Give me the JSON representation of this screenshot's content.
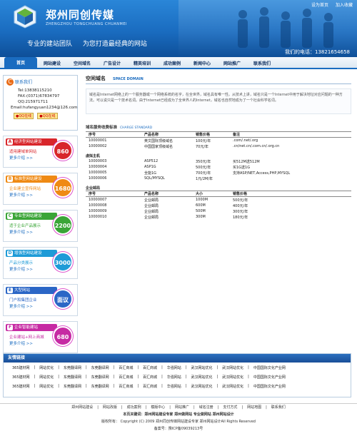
{
  "header": {
    "logo_text": "郑州同创传媒",
    "logo_sub": "ZHENGZHOU TONGCHUANG CHUANMEI",
    "top_links": [
      "设为首页",
      "加入收藏"
    ],
    "slogan": [
      "专业的建站团队",
      "为您打造最经典的网站"
    ],
    "phone": "我们的电话：13821654658"
  },
  "nav": {
    "items": [
      "首页",
      "网站建设",
      "空间域名",
      "广告设计",
      "精英培训",
      "成功案例",
      "新闻中心",
      "网站推广",
      "联系我们"
    ]
  },
  "contact": {
    "title": "联系我们",
    "lines": [
      "Tel:13838115210",
      "FAX:(0371)67834797",
      "QQ:215971711",
      "Email:hufangyuan1234@126.com"
    ],
    "qq_labels": [
      "QQ在线",
      "QQ在线"
    ]
  },
  "packages": [
    {
      "letter": "A",
      "name": "经济型网站建设",
      "l1": "适用建域单网站",
      "l2": "更多介绍 >>",
      "price": "860",
      "color": "#d8262b"
    },
    {
      "letter": "B",
      "name": "标准型网站建设",
      "l1": "企业建立宣传网站",
      "l2": "更多介绍 >>",
      "price": "1680",
      "color": "#ef8a14"
    },
    {
      "letter": "C",
      "name": "专业型网站建设",
      "l1": "适于企业产品展示",
      "l2": "更多介绍 >>",
      "price": "2200",
      "color": "#3aa537"
    },
    {
      "letter": "D",
      "name": "增强型网站建设",
      "l1": "产品分类展示",
      "l2": "更多介绍 >>",
      "price": "3000",
      "color": "#1e9bd7"
    },
    {
      "letter": "E",
      "name": "大型网站",
      "l1": "门户和集团企业",
      "l2": "更多介绍 >>",
      "price": "面议",
      "color": "#2b66c6"
    },
    {
      "letter": "F",
      "name": "企业智能建站",
      "l1": "企业建站+网上商城",
      "l2": "更多介绍 >>",
      "price": "680",
      "color": "#c62aa3"
    }
  ],
  "main": {
    "title": "空间域名",
    "title_en": "SPACE DOMAIN",
    "intro": "域名是Internet网络上的一个服务器或一个网络系统的名字，在全世界，域名具有唯一性。从技术上讲，域名只是一个Internet中用于解决地址对应问题的一种方法。可以说只是一个技术名词。由于Internet已经成为了全世界人的Internet，域名也自然地成为了一个社会科学名词。",
    "section_title": "域名服务收费标准",
    "section_en": "CHARGE STANDARD",
    "headers": [
      "序号",
      "产品名称",
      "销售价格",
      "备注"
    ],
    "domain_rows": [
      [
        "10000001",
        "英文国际顶级域名",
        "100元/年",
        ".com/.net/.org"
      ],
      [
        "10000002",
        "中国国家顶级域名",
        "70元/年",
        ".cn/net.cn/.com.cn/.org.cn"
      ]
    ],
    "vhost_title": "虚拟主机",
    "vhost_rows": [
      [
        "10000003",
        "ASP512",
        "350元/年",
        "买512M送512M"
      ],
      [
        "10000004",
        "ASP1G",
        "500元/年",
        "买1G送1G"
      ],
      [
        "10000005",
        "全能1G",
        "700元/年",
        "支持ASP/NET,Access,PHP,MYSQL"
      ],
      [
        "10000006",
        "SQL/MYSQL",
        "1元/2M/年",
        ""
      ]
    ],
    "mail_title": "企业邮局",
    "mail_headers": [
      "序号",
      "产品名称",
      "大小",
      "销售价格"
    ],
    "mail_rows": [
      [
        "10000007",
        "企业邮局",
        "1000M",
        "500元/年"
      ],
      [
        "10000008",
        "企业邮局",
        "600M",
        "400元/年"
      ],
      [
        "10000009",
        "企业邮局",
        "500M",
        "300元/年"
      ],
      [
        "10000010",
        "企业邮局",
        "300M",
        "180元/年"
      ]
    ]
  },
  "links": {
    "title": "友情链接",
    "rows": [
      [
        "365建材网",
        "网站优化",
        "东莞翻译网",
        "东莞翻译网",
        "百汇商城",
        "百汇商城",
        "华强网站",
        "武汉网站优化",
        "武汉网站优化",
        "中国国际文化产业网"
      ],
      [
        "365建材网",
        "网站优化",
        "东莞翻译网",
        "东莞翻译网",
        "百汇商城",
        "百汇商城",
        "华强网站",
        "武汉网站优化",
        "武汉网站优化",
        "中国国际文化产业网"
      ],
      [
        "365建材网",
        "网站优化",
        "东莞翻译网",
        "东莞翻译网",
        "百汇商城",
        "百汇商城",
        "华强网站",
        "武汉网站优化",
        "武汉网站优化",
        "中国国际文化产业网"
      ]
    ]
  },
  "footer": {
    "links": [
      "郑州网站建设",
      "网站改版",
      "成功案例",
      "模版中心",
      "网站推广",
      "域名注册",
      "支付方式",
      "网站地图",
      "联系我们"
    ],
    "keywords": "本页关键词：郑州网站建设专家  郑州做网站  专业做网站  郑州网站设计",
    "copyright": "版权所有： Copyright (C) 2009 郑州同创传媒网站建设专家 郑州网站设计All Rights Reserved",
    "icp": "备案号：豫ICP备09039213号"
  }
}
